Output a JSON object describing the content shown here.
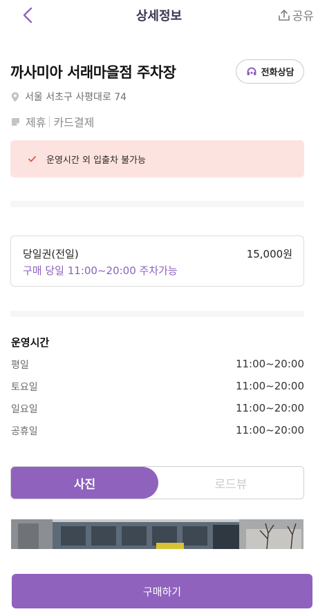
{
  "header": {
    "title": "상세정보",
    "share_label": "공유"
  },
  "place": {
    "name": "까사미아 서래마을점 주차장",
    "call_label": "전화상담",
    "address": "서울 서초구 사평대로 74",
    "tags": [
      "제휴",
      "카드결제"
    ]
  },
  "notice": {
    "text": "운영시간 외 입출차 불가능",
    "accent_color": "#e0554a"
  },
  "ticket": {
    "name": "당일권(전일)",
    "price": "15,000원",
    "desc": "구매 당일 11:00~20:00 주차가능"
  },
  "hours": {
    "title": "운영시간",
    "rows": [
      {
        "day": "평일",
        "time": "11:00~20:00"
      },
      {
        "day": "토요일",
        "time": "11:00~20:00"
      },
      {
        "day": "일요일",
        "time": "11:00~20:00"
      },
      {
        "day": "공휴일",
        "time": "11:00~20:00"
      }
    ]
  },
  "tabs": {
    "photo": "사진",
    "roadview": "로드뷰",
    "active": "photo"
  },
  "footer": {
    "buy_label": "구매하기"
  },
  "colors": {
    "brand": "#8f62bd",
    "notice_bg": "#fde3df"
  }
}
